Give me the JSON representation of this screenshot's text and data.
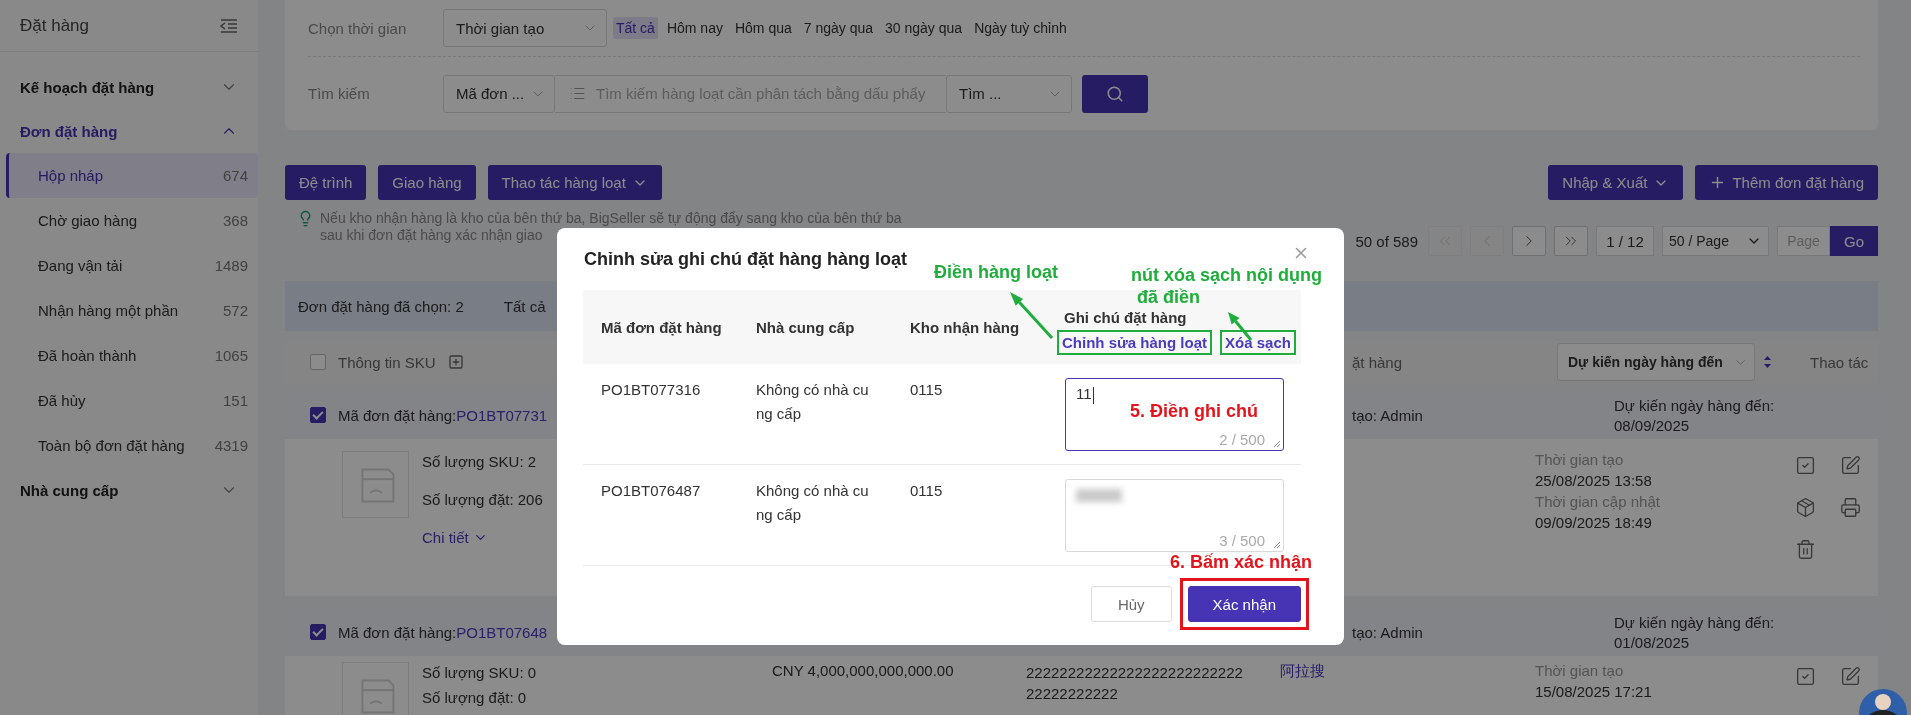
{
  "sidebar": {
    "title": "Đặt hàng",
    "groups": [
      {
        "label": "Kế hoạch đặt hàng",
        "expanded": false,
        "selected": false
      },
      {
        "label": "Đơn đặt hàng",
        "expanded": true,
        "selected": true,
        "items": [
          {
            "label": "Hộp nháp",
            "count": "674",
            "selected": true
          },
          {
            "label": "Chờ giao hàng",
            "count": "368",
            "selected": false
          },
          {
            "label": "Đang vận tải",
            "count": "1489",
            "selected": false
          },
          {
            "label": "Nhận hàng một phần",
            "count": "572",
            "selected": false
          },
          {
            "label": "Đã hoàn thành",
            "count": "1065",
            "selected": false
          },
          {
            "label": "Đã hủy",
            "count": "151",
            "selected": false
          },
          {
            "label": "Toàn bộ đơn đặt hàng",
            "count": "4319",
            "selected": false
          }
        ]
      },
      {
        "label": "Nhà cung cấp",
        "expanded": false,
        "selected": false
      }
    ]
  },
  "filters": {
    "time": {
      "label": "Chọn thời gian",
      "select": "Thời gian tạo",
      "options": [
        {
          "label": "Tất cả",
          "selected": true
        },
        {
          "label": "Hôm nay",
          "selected": false
        },
        {
          "label": "Hôm qua",
          "selected": false
        },
        {
          "label": "7 ngày qua",
          "selected": false
        },
        {
          "label": "30 ngày qua",
          "selected": false
        },
        {
          "label": "Ngày tuỳ chỉnh",
          "selected": false
        }
      ]
    },
    "search": {
      "label": "Tìm kiếm",
      "field_select": "Mã đơn ...",
      "placeholder": "Tìm kiếm hàng loạt cần phân tách bằng dấu phẩy",
      "mode_select": "Tìm ..."
    }
  },
  "toolbar": {
    "left": [
      {
        "label": "Đệ trình",
        "kind": "plain"
      },
      {
        "label": "Giao hàng",
        "kind": "plain"
      },
      {
        "label": "Thao tác hàng loạt",
        "kind": "dropdown"
      }
    ],
    "right": [
      {
        "label": "Nhập & Xuất",
        "kind": "dropdown"
      },
      {
        "label": "Thêm đơn đặt hàng",
        "kind": "add"
      }
    ]
  },
  "tip": {
    "lines": [
      "Nếu kho nhận hàng là kho của bên thứ ba, BigSeller sẽ tự động đẩy sang kho của bên thứ ba",
      "sau khi đơn đặt hàng xác nhận giao"
    ]
  },
  "pagination": {
    "range": "50 of 589",
    "nav": [
      {
        "kind": "first",
        "disabled": true
      },
      {
        "kind": "prev",
        "disabled": true
      },
      {
        "kind": "next",
        "disabled": false
      },
      {
        "kind": "last",
        "disabled": false
      }
    ],
    "page": "1 / 12",
    "page_size": "50 / Page",
    "jump_placeholder": "Page",
    "go": "Go"
  },
  "selection_bar": {
    "selected": "Đơn đặt hàng đã chọn: 2",
    "all": "Tất cả"
  },
  "table": {
    "header": {
      "checked": false,
      "sku": "Thông tin SKU",
      "column_3": "ặt hàng",
      "date_select": "Dự kiến ngày hàng đến",
      "actions": "Thao tác"
    },
    "orders": [
      {
        "checked": true,
        "code_label": "Mã đơn đặt hàng:",
        "code": "PO1BT07731",
        "creator": "tạo: Admin",
        "eta_label": "Dự kiến ngày hàng đến:",
        "eta": "08/09/2025",
        "sku_count": "Số lượng SKU: 2",
        "qty": "Số lượng đặt: 206",
        "details": "Chi tiết",
        "times": [
          {
            "label": "Thời gian tạo",
            "value": "25/08/2025 13:58"
          },
          {
            "label": "Thời gian cập nhật",
            "value": "09/09/2025 18:49"
          }
        ],
        "actions": [
          {
            "kind": "approve"
          },
          {
            "kind": "edit"
          },
          {
            "kind": "ship"
          },
          {
            "kind": "print"
          },
          {
            "kind": "delete"
          }
        ]
      },
      {
        "checked": true,
        "code_label": "Mã đơn đặt hàng:",
        "code": "PO1BT07648",
        "creator": "tạo: Admin",
        "eta_label": "Dự kiến ngày hàng đến:",
        "eta": "01/08/2025",
        "sku_count": "Số lượng SKU: 0",
        "qty": "Số lượng đặt: 0",
        "amount": "CNY 4,000,000,000,000.00",
        "column_note": "2222222222222222222222222222222222222",
        "supplier": "阿拉搜",
        "times": [
          {
            "label": "Thời gian tạo",
            "value": "15/08/2025 17:21"
          }
        ],
        "actions": [
          {
            "kind": "approve"
          },
          {
            "kind": "edit"
          }
        ]
      }
    ]
  },
  "modal": {
    "title": "Chỉnh sửa ghi chú đặt hàng hàng loạt",
    "columns": [
      "Mã đơn đặt hàng",
      "Nhà cung cấp",
      "Kho nhận hàng"
    ],
    "note_column": {
      "title": "Ghi chú đặt hàng",
      "links": [
        {
          "label": "Chỉnh sửa hàng loạt",
          "color": "#1fae3c"
        },
        {
          "label": "Xóa sạch",
          "color": "#1fae3c"
        }
      ]
    },
    "rows": [
      {
        "code": "PO1BT077316",
        "supplier": "Không có nhà cung cấp",
        "warehouse": "0115",
        "note": "11",
        "count": "2 / 500",
        "focused": true,
        "blurred": false
      },
      {
        "code": "PO1BT076487",
        "supplier": "Không có nhà cung cấp",
        "warehouse": "0115",
        "count": "3 / 500",
        "focused": false,
        "blurred": true
      }
    ],
    "buttons": [
      {
        "label": "Hủy",
        "kind": "secondary"
      },
      {
        "label": "Xác nhận",
        "kind": "primary",
        "color": "#e3141c"
      }
    ]
  },
  "annotations": [
    {
      "lines": [
        "Điền hàng loạt"
      ],
      "color": "#1fae3c"
    },
    {
      "lines": [
        "nút xóa sạch nội dụng",
        "đã điền"
      ],
      "color": "#1fae3c"
    },
    {
      "lines": [
        "5. Điền ghi chú"
      ],
      "color": "#e3141c"
    },
    {
      "lines": [
        "6. Bấm xác nhận"
      ],
      "color": "#e3141c"
    }
  ]
}
